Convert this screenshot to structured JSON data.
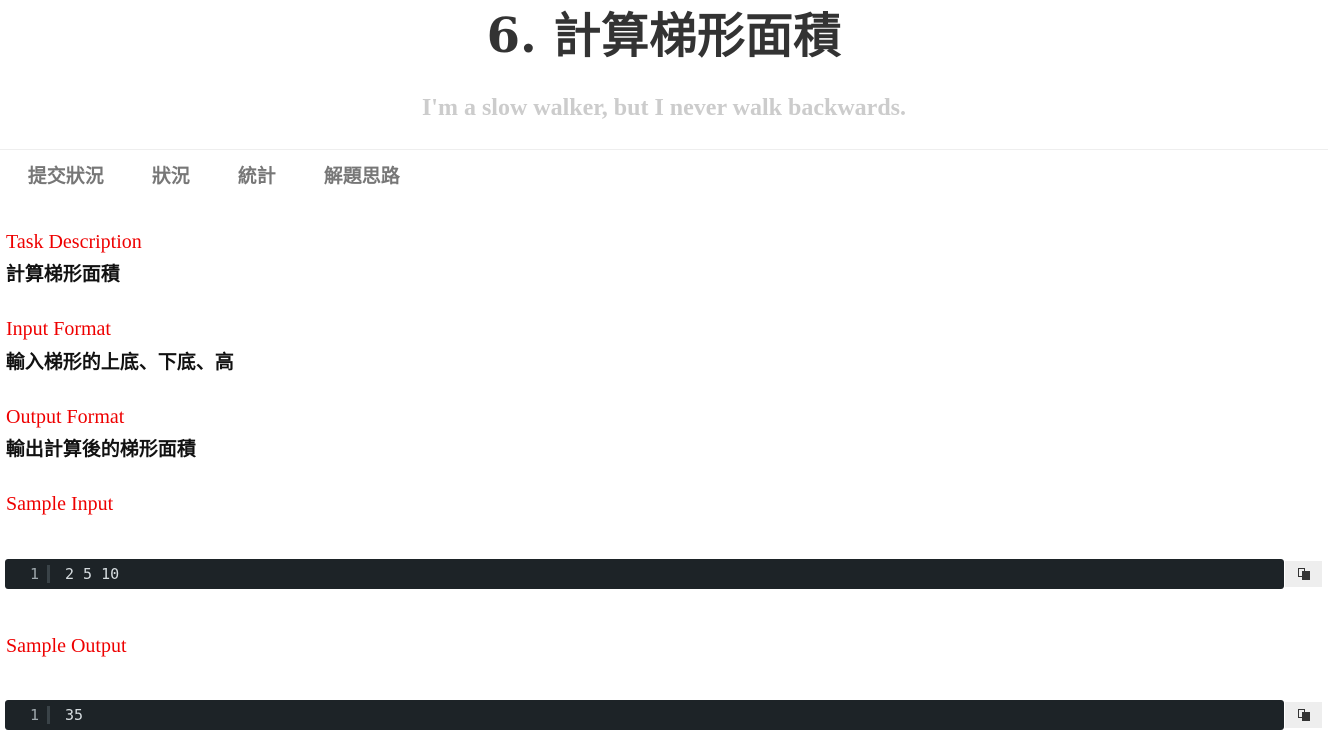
{
  "header": {
    "title": "6. 計算梯形面積",
    "tagline": "I'm a slow walker, but I never walk backwards."
  },
  "tabs": [
    {
      "label": "提交狀況"
    },
    {
      "label": "狀況"
    },
    {
      "label": "統計"
    },
    {
      "label": "解題思路"
    }
  ],
  "sections": {
    "task_description": {
      "label": "Task Description",
      "body": "計算梯形面積"
    },
    "input_format": {
      "label": "Input Format",
      "body": "輸入梯形的上底、下底、高"
    },
    "output_format": {
      "label": "Output Format",
      "body": "輸出計算後的梯形面積"
    },
    "sample_input": {
      "label": "Sample Input",
      "line_number": "1",
      "code": "2 5 10"
    },
    "sample_output": {
      "label": "Sample Output",
      "line_number": "1",
      "code": "35"
    }
  },
  "icons": {
    "copy": "copy-icon"
  },
  "colors": {
    "section_label": "#ee0000",
    "code_bg": "#1d2327",
    "tagline": "#cccccc"
  }
}
